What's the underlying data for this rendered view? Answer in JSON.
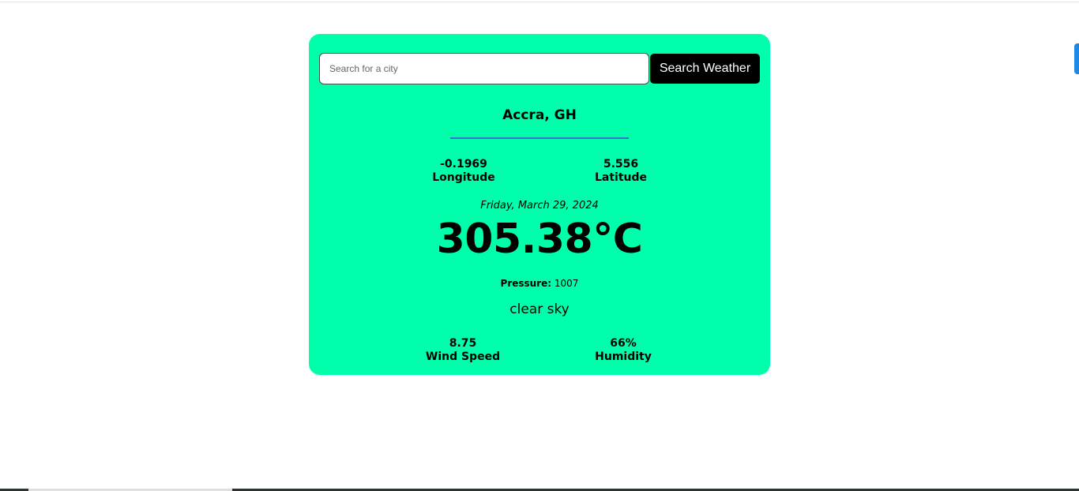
{
  "colors": {
    "card_background": "#00ffaa",
    "button_background": "#000000",
    "divider": "#3b73c8",
    "side_tab": "#1e88e5"
  },
  "search": {
    "placeholder": "Search for a city",
    "value": "",
    "button_label": "Search Weather"
  },
  "weather": {
    "city": "Accra, GH",
    "longitude_value": "-0.1969",
    "longitude_label": "Longitude",
    "latitude_value": "5.556",
    "latitude_label": "Latitude",
    "date": "Friday, March 29, 2024",
    "temperature": "305.38°C",
    "pressure_label": "Pressure:",
    "pressure_value": "1007",
    "description": "clear sky",
    "wind_speed_value": "8.75",
    "wind_speed_label": "Wind Speed",
    "humidity_value": "66%",
    "humidity_label": "Humidity"
  }
}
